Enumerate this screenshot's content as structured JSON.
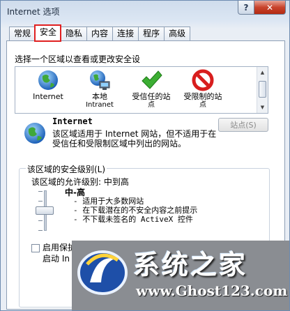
{
  "window": {
    "title": "Internet 选项",
    "help_label": "?",
    "close_label": "✕"
  },
  "tabs": [
    {
      "label": "常规",
      "active": false
    },
    {
      "label": "安全",
      "active": true
    },
    {
      "label": "隐私",
      "active": false
    },
    {
      "label": "内容",
      "active": false
    },
    {
      "label": "连接",
      "active": false
    },
    {
      "label": "程序",
      "active": false
    },
    {
      "label": "高级",
      "active": false
    }
  ],
  "security": {
    "zone_prompt": "选择一个区域以查看或更改安全设",
    "zones": [
      {
        "label": "Internet",
        "label2": "",
        "icon": "globe-icon"
      },
      {
        "label": "本地",
        "label2": "Intranet",
        "icon": "local-intranet-icon"
      },
      {
        "label": "受信任的站",
        "label2": "点",
        "icon": "checkmark-icon"
      },
      {
        "label": "受限制的站",
        "label2": "点",
        "icon": "no-entry-icon"
      }
    ],
    "selected_zone": {
      "title": "Internet",
      "description": "该区域适用于 Internet 网站，但不适用于在受信任和受限制区域中列出的网站。"
    },
    "sites_button": "站点(S)",
    "level_group": {
      "legend": "该区域的安全级别(L)",
      "allowed_levels": "该区域的允许级别: 中到高",
      "level_name": "中-高",
      "bullets": [
        "- 适用于大多数网站",
        "- 在下载潜在的不安全内容之前提示",
        "- 不下载未签名的 ActiveX 控件"
      ],
      "slider_level": "中-高",
      "protected_mode_line1": "启用保护",
      "protected_mode_line2": "启动 In"
    }
  },
  "watermark": {
    "title": "系统之家",
    "url": "www.Ghost123.com"
  },
  "colors": {
    "accent_red": "#e02020",
    "watermark_bg": "#8a8d92"
  }
}
